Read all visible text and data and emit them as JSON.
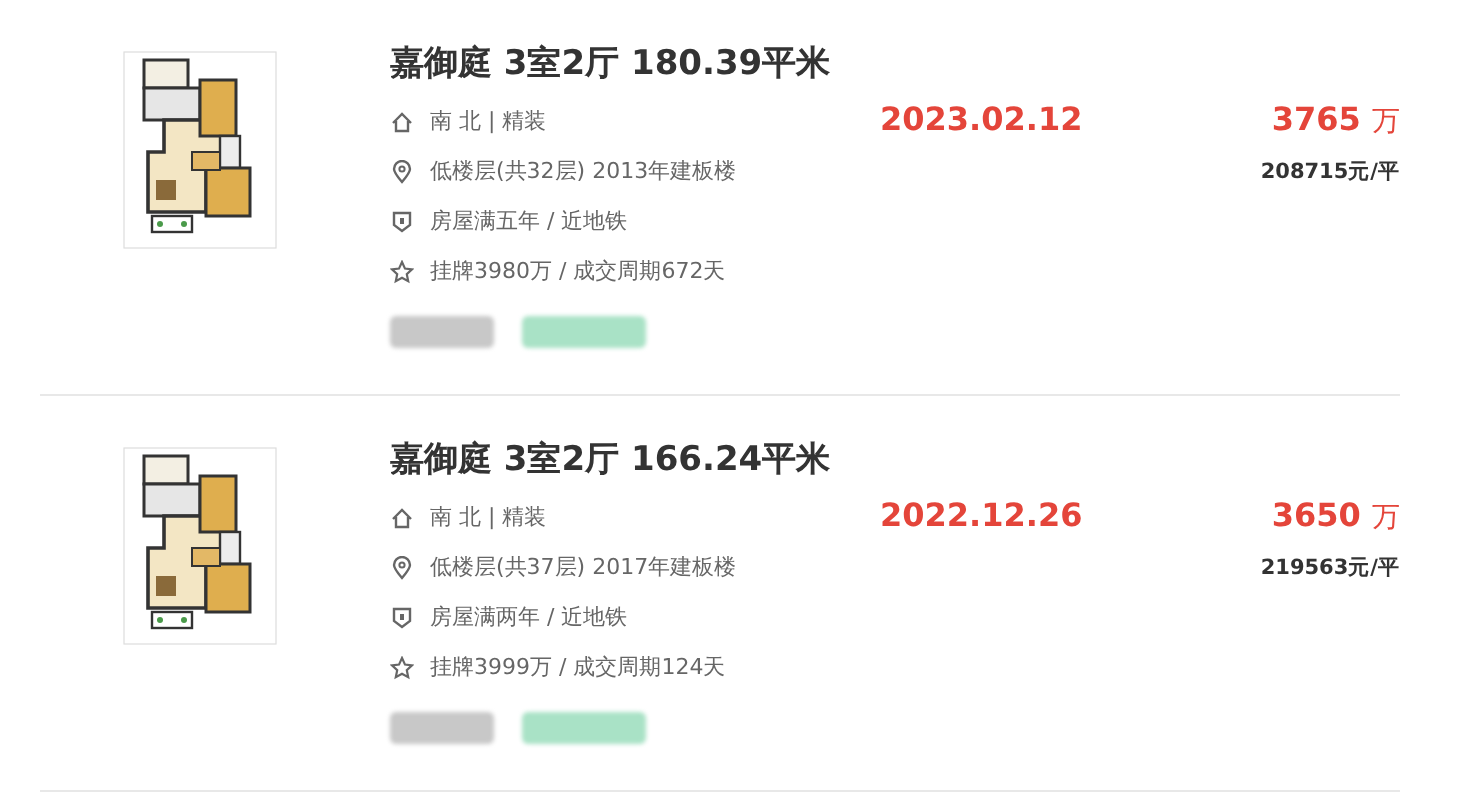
{
  "listings": [
    {
      "title": "嘉御庭 3室2厅 180.39平米",
      "details": [
        {
          "kind": "house",
          "text": "南 北 | 精装"
        },
        {
          "kind": "location",
          "text": "低楼层(共32层) 2013年建板楼"
        },
        {
          "kind": "shield",
          "text": "房屋满五年 / 近地铁"
        },
        {
          "kind": "star",
          "text": "挂牌3980万 / 成交周期672天"
        }
      ],
      "deal_date": "2023.02.12",
      "price": "3765",
      "price_unit": "万",
      "unit_price": "208715元/平",
      "blurred_tags": [
        {
          "color": "#c8c8c8"
        },
        {
          "color": "#a9e2c6"
        }
      ]
    },
    {
      "title": "嘉御庭 3室2厅 166.24平米",
      "details": [
        {
          "kind": "house",
          "text": "南 北 | 精装"
        },
        {
          "kind": "location",
          "text": "低楼层(共37层) 2017年建板楼"
        },
        {
          "kind": "shield",
          "text": "房屋满两年 / 近地铁"
        },
        {
          "kind": "star",
          "text": "挂牌3999万 / 成交周期124天"
        }
      ],
      "deal_date": "2022.12.26",
      "price": "3650",
      "price_unit": "万",
      "unit_price": "219563元/平",
      "blurred_tags": [
        {
          "color": "#c8c8c8"
        },
        {
          "color": "#a9e2c6"
        }
      ]
    }
  ]
}
